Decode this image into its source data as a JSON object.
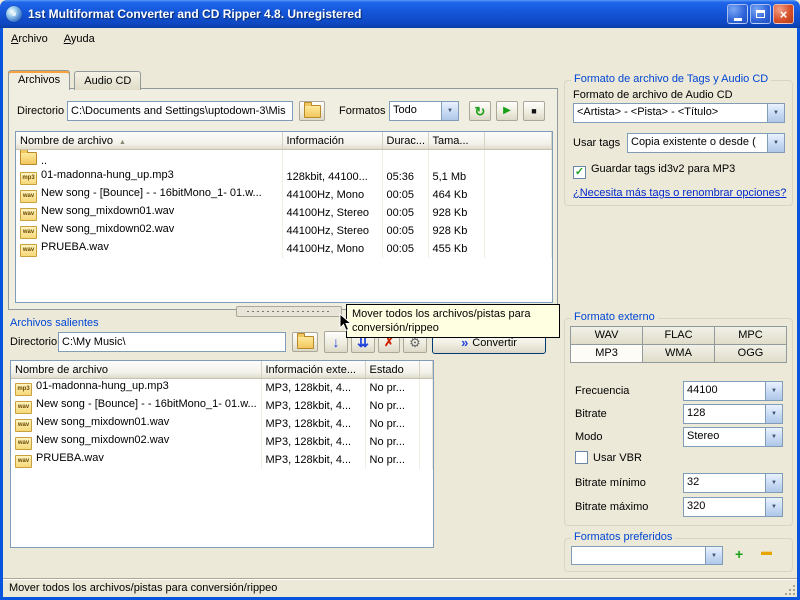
{
  "window": {
    "title": "1st Multiformat Converter and CD Ripper 4.8. Unregistered"
  },
  "menu": {
    "items": [
      "Archivo",
      "Ayuda"
    ]
  },
  "icons": {
    "close": "×",
    "refresh": "↻",
    "play": "▶",
    "stop": "■",
    "arrow_down": "↓",
    "arrow_double_down": "⇊",
    "delete": "✗",
    "tools": "⚙",
    "convert_chevrons": "»",
    "sort_asc": "▲",
    "combo_arrow": "▼",
    "check": "✓",
    "plus": "+",
    "minus": "▬"
  },
  "source_panel": {
    "tabs": [
      {
        "label": "Archivos"
      },
      {
        "label": "Audio CD"
      }
    ],
    "directory_label": "Directorio",
    "directory_value": "C:\\Documents and Settings\\uptodown-3\\Mis",
    "formats_label": "Formatos",
    "formats_value": "Todo",
    "table": {
      "headers": [
        "Nombre de archivo",
        "Información",
        "Durac...",
        "Tama..."
      ],
      "rows": [
        {
          "icon": "folder",
          "name": "..",
          "info": "",
          "duration": "",
          "size": ""
        },
        {
          "icon": "mp3",
          "name": "01-madonna-hung_up.mp3",
          "info": "128kbit, 44100...",
          "duration": "05:36",
          "size": "5,1 Mb"
        },
        {
          "icon": "wav",
          "name": "New song - [Bounce] - - 16bitMono_1- 01.w...",
          "info": "44100Hz, Mono",
          "duration": "00:05",
          "size": "464 Kb"
        },
        {
          "icon": "wav",
          "name": "New song_mixdown01.wav",
          "info": "44100Hz, Stereo",
          "duration": "00:05",
          "size": "928 Kb"
        },
        {
          "icon": "wav",
          "name": "New song_mixdown02.wav",
          "info": "44100Hz, Stereo",
          "duration": "00:05",
          "size": "928 Kb"
        },
        {
          "icon": "wav",
          "name": "PRUEBA.wav",
          "info": "44100Hz, Mono",
          "duration": "00:05",
          "size": "455 Kb"
        }
      ]
    }
  },
  "splitter_tooltip": {
    "line1": "Mover todos los archivos/pistas para",
    "line2": "conversión/rippeo"
  },
  "output_panel": {
    "title": "Archivos salientes",
    "directory_label": "Directorio",
    "directory_value": "C:\\My Music\\",
    "convert_label": "Convertir",
    "table": {
      "headers": [
        "Nombre de archivo",
        "Información exte...",
        "Estado"
      ],
      "rows": [
        {
          "icon": "mp3",
          "name": "01-madonna-hung_up.mp3",
          "info": "MP3, 128kbit, 4...",
          "status": "No pr..."
        },
        {
          "icon": "wav",
          "name": "New song - [Bounce] - - 16bitMono_1- 01.w...",
          "info": "MP3, 128kbit, 4...",
          "status": "No pr..."
        },
        {
          "icon": "wav",
          "name": "New song_mixdown01.wav",
          "info": "MP3, 128kbit, 4...",
          "status": "No pr..."
        },
        {
          "icon": "wav",
          "name": "New song_mixdown02.wav",
          "info": "MP3, 128kbit, 4...",
          "status": "No pr..."
        },
        {
          "icon": "wav",
          "name": "PRUEBA.wav",
          "info": "MP3, 128kbit, 4...",
          "status": "No pr..."
        }
      ]
    }
  },
  "tags_panel": {
    "group_title": "Formato de archivo de Tags y Audio CD",
    "audio_cd_label": "Formato de archivo de Audio CD",
    "audio_cd_value": "<Artista> - <Pista> - <Título>",
    "use_tags_label": "Usar tags",
    "use_tags_value": "Copia existente o desde (",
    "id3v2_label": "Guardar tags id3v2 para MP3",
    "link": "¿Necesita más tags o renombrar opciones?"
  },
  "external_panel": {
    "group_title": "Formato externo",
    "format_tabs": [
      {
        "label": "WAV"
      },
      {
        "label": "FLAC"
      },
      {
        "label": "MPC"
      },
      {
        "label": "MP3",
        "active": true
      },
      {
        "label": "WMA"
      },
      {
        "label": "OGG"
      }
    ],
    "frequency_label": "Frecuencia",
    "frequency_value": "44100",
    "bitrate_label": "Bitrate",
    "bitrate_value": "128",
    "mode_label": "Modo",
    "mode_value": "Stereo",
    "vbr_label": "Usar VBR",
    "bitrate_min_label": "Bitrate mínimo",
    "bitrate_min_value": "32",
    "bitrate_max_label": "Bitrate máximo",
    "bitrate_max_value": "320"
  },
  "preferred_panel": {
    "group_title": "Formatos preferidos",
    "value": ""
  },
  "status_bar": {
    "text": "Mover todos los archivos/pistas para conversión/rippeo"
  },
  "colors": {
    "titlebar_blue": "#1557DB",
    "group_title_blue": "#0046D5",
    "link_blue": "#0228CB",
    "tooltip_bg": "#FFFFE1",
    "window_bg": "#ECE9D8"
  }
}
